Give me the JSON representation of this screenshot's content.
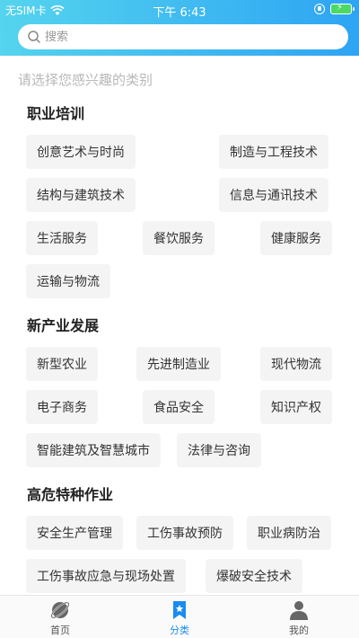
{
  "status": {
    "carrier": "无SIM卡",
    "time": "下午 6:43"
  },
  "search": {
    "placeholder": "搜索"
  },
  "hint": "请选择您感兴趣的类别",
  "sections": [
    {
      "title": "职业培训",
      "tags": [
        "创意艺术与时尚",
        "制造与工程技术",
        "结构与建筑技术",
        "信息与通讯技术",
        "生活服务",
        "餐饮服务",
        "健康服务",
        "运输与物流"
      ]
    },
    {
      "title": "新产业发展",
      "tags": [
        "新型农业",
        "先进制造业",
        "现代物流",
        "电子商务",
        "食品安全",
        "知识产权",
        "智能建筑及智慧城市",
        "法律与咨询"
      ]
    },
    {
      "title": "高危特种作业",
      "tags": [
        "安全生产管理",
        "工伤事故预防",
        "职业病防治",
        "工伤事故应急与现场处置",
        "爆破安全技术"
      ]
    }
  ],
  "tabbar": {
    "items": [
      {
        "label": "首页",
        "icon": "planet-icon"
      },
      {
        "label": "分类",
        "icon": "bookmark-star-icon"
      },
      {
        "label": "我的",
        "icon": "user-icon"
      }
    ],
    "active": "分类",
    "active_color": "#1a8cf0"
  }
}
